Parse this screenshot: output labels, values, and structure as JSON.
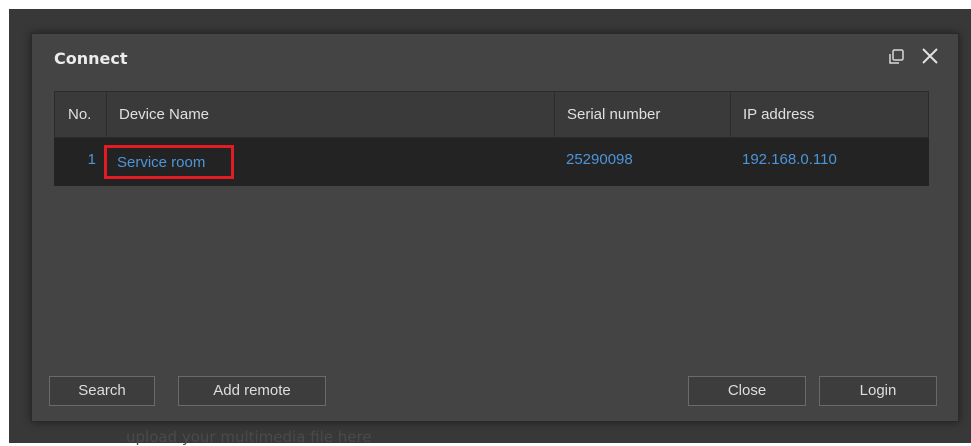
{
  "background": {
    "hint_text": "upload your multimedia file here"
  },
  "dialog": {
    "title": "Connect",
    "window_controls": {
      "restore_icon": "restore-window-icon",
      "close_icon": "close-icon"
    }
  },
  "table": {
    "columns": [
      "No.",
      "Device Name",
      "Serial number",
      "IP address"
    ],
    "rows": [
      {
        "no": "1",
        "device_name": "Service room",
        "serial_number": "25290098",
        "ip_address": "192.168.0.110",
        "highlighted": true
      }
    ]
  },
  "buttons": {
    "search": "Search",
    "add_remote": "Add remote",
    "close": "Close",
    "login": "Login"
  },
  "colors": {
    "dialog_bg": "#444444",
    "row_selected_bg": "#232323",
    "link_text": "#4d95d8",
    "highlight_box": "#e31b23"
  }
}
